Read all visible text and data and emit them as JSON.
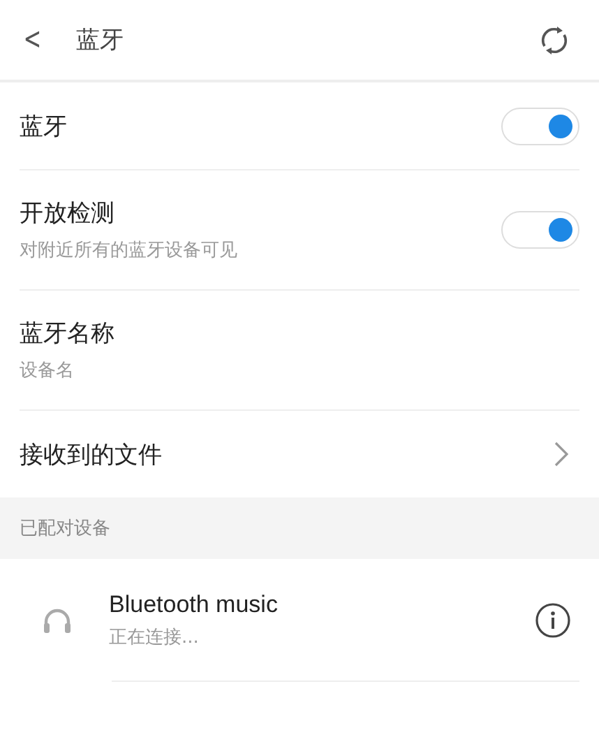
{
  "header": {
    "back": "<",
    "title": "蓝牙"
  },
  "settings": [
    {
      "kind": "toggle",
      "title": "蓝牙",
      "on": true
    },
    {
      "kind": "toggle",
      "title": "开放检测",
      "subtitle": "对附近所有的蓝牙设备可见",
      "on": true
    },
    {
      "kind": "plain",
      "title": "蓝牙名称",
      "subtitle": "设备名"
    },
    {
      "kind": "link",
      "title": "接收到的文件"
    }
  ],
  "paired_section": {
    "title": "已配对设备",
    "devices": [
      {
        "name": "Bluetooth music",
        "status": "正在连接..."
      }
    ]
  }
}
